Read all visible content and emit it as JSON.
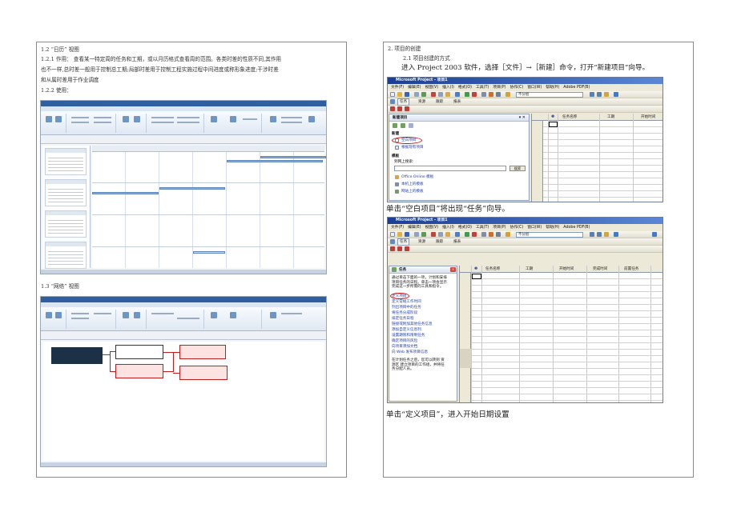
{
  "left": {
    "s12_heading": "1.2 “日历” 视图",
    "s121_line1": "1.2.1 作用： 查看某一特定周的任务和工期，或以月历格式查看周的范围。各类时差的性质不同,其作用",
    "s121_line2": "也不一样,总时差一般用于控制总工期;局部时差用于控制工程实施过程中间进度或称形象进度;干涉时差",
    "s121_line3": "和从属时差用于作业调度",
    "s122_heading": "1.2.2 使用：",
    "s13_heading": "1.3 “网络” 视图"
  },
  "right": {
    "s2_heading": "2. 项目的创建",
    "s21_heading": "2.1 项目创建的方式",
    "intro": "进入 Project 2003 软件，选择［文件］→［新建］命令，打开“新建项目”向导。",
    "caption1": "单击“空白项目”将出现“任务”向导。",
    "caption2": "单击“定义项目”，进入开始日期设置"
  },
  "shot1": {
    "title": "Microsoft Project - 项目1",
    "menu": [
      "文件(F)",
      "编辑(E)",
      "视图(V)",
      "插入(I)",
      "格式(O)",
      "工具(T)",
      "项目(P)",
      "协作(C)",
      "窗口(W)",
      "帮助(H)",
      "Adobe PDF(B)"
    ],
    "toolbar_group": "不分组",
    "toolbar2": [
      "任务",
      "资源",
      "跟踪",
      "报表"
    ],
    "pane_title": "新建项目",
    "new_label": "新建",
    "link_blank": "空白项目",
    "link_existing": "根据现有项目",
    "template_label": "模板",
    "search_label": "到网上搜索:",
    "search_btn": "搜索",
    "link_online": "Office Online 模板",
    "link_local": "本机上的模板",
    "link_web": "网站上的模板",
    "col_task": "任务名称",
    "col_duration": "工期",
    "col_start": "开始时间"
  },
  "shot2": {
    "title": "Microsoft Project - 项目1",
    "menu": [
      "文件(F)",
      "编辑(E)",
      "视图(V)",
      "插入(I)",
      "格式(O)",
      "工具(T)",
      "项目(P)",
      "协作(C)",
      "窗口(W)",
      "帮助(H)",
      "Adobe PDF(B)"
    ],
    "toolbar_group": "不分组",
    "toolbar2": [
      "任务",
      "资源",
      "跟踪",
      "报表"
    ],
    "pane_title": "任务",
    "intro": [
      "通过单击下面的一项，计划和安排",
      "项目任务的日程。单击一项会显示",
      "完成这一步所需的工具和指令。"
    ],
    "steps": [
      "定义项目",
      "定义常规工作时间",
      "列出项目中的任务",
      "将任务分成阶段",
      "排定任务日程",
      "链接或附加其他任务信息",
      "添加自定义信息列",
      "设置期限和限制任务",
      "确定项目的风险",
      "向项目添加文档",
      "向 Web 发布项目信息"
    ],
    "footer": [
      "在计划任务之后，您可以转到 资",
      "源区 建立项目的工作组，并将任",
      "务分配人员。"
    ],
    "col_task": "任务名称",
    "col_duration": "工期",
    "col_start": "开始时间",
    "col_finish": "完成时间",
    "col_pred": "前置任务"
  }
}
